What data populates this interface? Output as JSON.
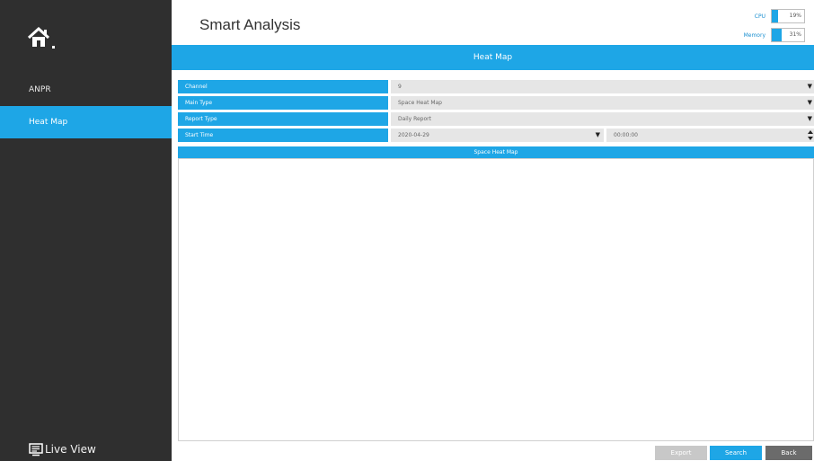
{
  "sidebar": {
    "items": [
      {
        "label": "ANPR",
        "active": false
      },
      {
        "label": "Heat Map",
        "active": true
      }
    ],
    "live_view_label": "Live View",
    "home_icon": "home-icon",
    "live_view_icon": "monitor-icon"
  },
  "header": {
    "title": "Smart Analysis",
    "cpu": {
      "label": "CPU",
      "value": "19%",
      "fraction": 0.19
    },
    "memory": {
      "label": "Memory",
      "value": "31%",
      "fraction": 0.31
    }
  },
  "section_title": "Heat Map",
  "form": {
    "channel": {
      "label": "Channel",
      "value": "9"
    },
    "main_type": {
      "label": "Main Type",
      "value": "Space Heat Map"
    },
    "report_type": {
      "label": "Report Type",
      "value": "Daily Report"
    },
    "start_time": {
      "label": "Start Time",
      "date": "2020-04-29",
      "time": "00:00:00"
    }
  },
  "result_title": "Space Heat Map",
  "buttons": {
    "export": "Export",
    "search": "Search",
    "back": "Back"
  },
  "colors": {
    "accent": "#1ea6e6",
    "sidebar": "#2f2f2f",
    "field": "#e6e6e6"
  }
}
